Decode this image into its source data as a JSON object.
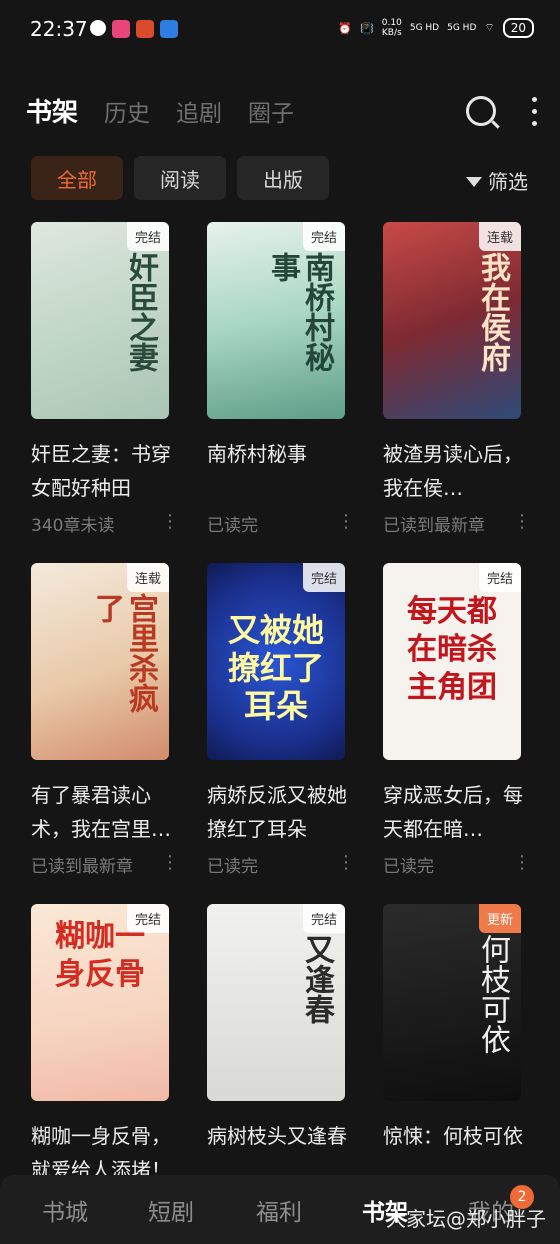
{
  "status_bar": {
    "time": "22:37",
    "net_speed": "0.10",
    "net_unit": "KB/s",
    "signal1": "5G HD",
    "signal2": "5G HD",
    "battery": "20"
  },
  "top_tabs": [
    "书架",
    "历史",
    "追剧",
    "圈子"
  ],
  "filter_chips": [
    "全部",
    "阅读",
    "出版"
  ],
  "filter_label": "筛选",
  "books": [
    {
      "title": "奸臣之妻：书穿女配好种田",
      "cover_title": "奸臣之妻",
      "status": "340章未读",
      "badge": "完结"
    },
    {
      "title": "南桥村秘事",
      "cover_title": "南桥村秘事",
      "status": "已读完",
      "badge": "完结"
    },
    {
      "title": "被渣男读心后，我在侯…",
      "cover_title": "我在侯府",
      "status": "已读到最新章",
      "badge": "连载"
    },
    {
      "title": "有了暴君读心术，我在宫里…",
      "cover_title": "宫里杀疯了",
      "status": "已读到最新章",
      "badge": "连载"
    },
    {
      "title": "病娇反派又被她撩红了耳朵",
      "cover_title": "又被她撩红了耳朵",
      "status": "已读完",
      "badge": "完结"
    },
    {
      "title": "穿成恶女后，每天都在暗…",
      "cover_title": "每天都在暗杀主角团",
      "status": "已读完",
      "badge": "完结"
    },
    {
      "title": "糊咖一身反骨，就爱给人添堵！",
      "cover_title": "糊咖一身反骨",
      "status": "",
      "badge": "完结"
    },
    {
      "title": "病树枝头又逢春",
      "cover_title": "又逢春",
      "status": "",
      "badge": "完结"
    },
    {
      "title": "惊悚：何枝可依",
      "cover_title": "何枝可依",
      "status": "",
      "badge": "更新"
    }
  ],
  "bottom_nav": [
    "书城",
    "短剧",
    "福利",
    "书架",
    "我的"
  ],
  "notification_count": "2",
  "watermark": "大家坛@郑小胖子",
  "colors": {
    "accent": "#f06a35",
    "background": "#151515"
  }
}
